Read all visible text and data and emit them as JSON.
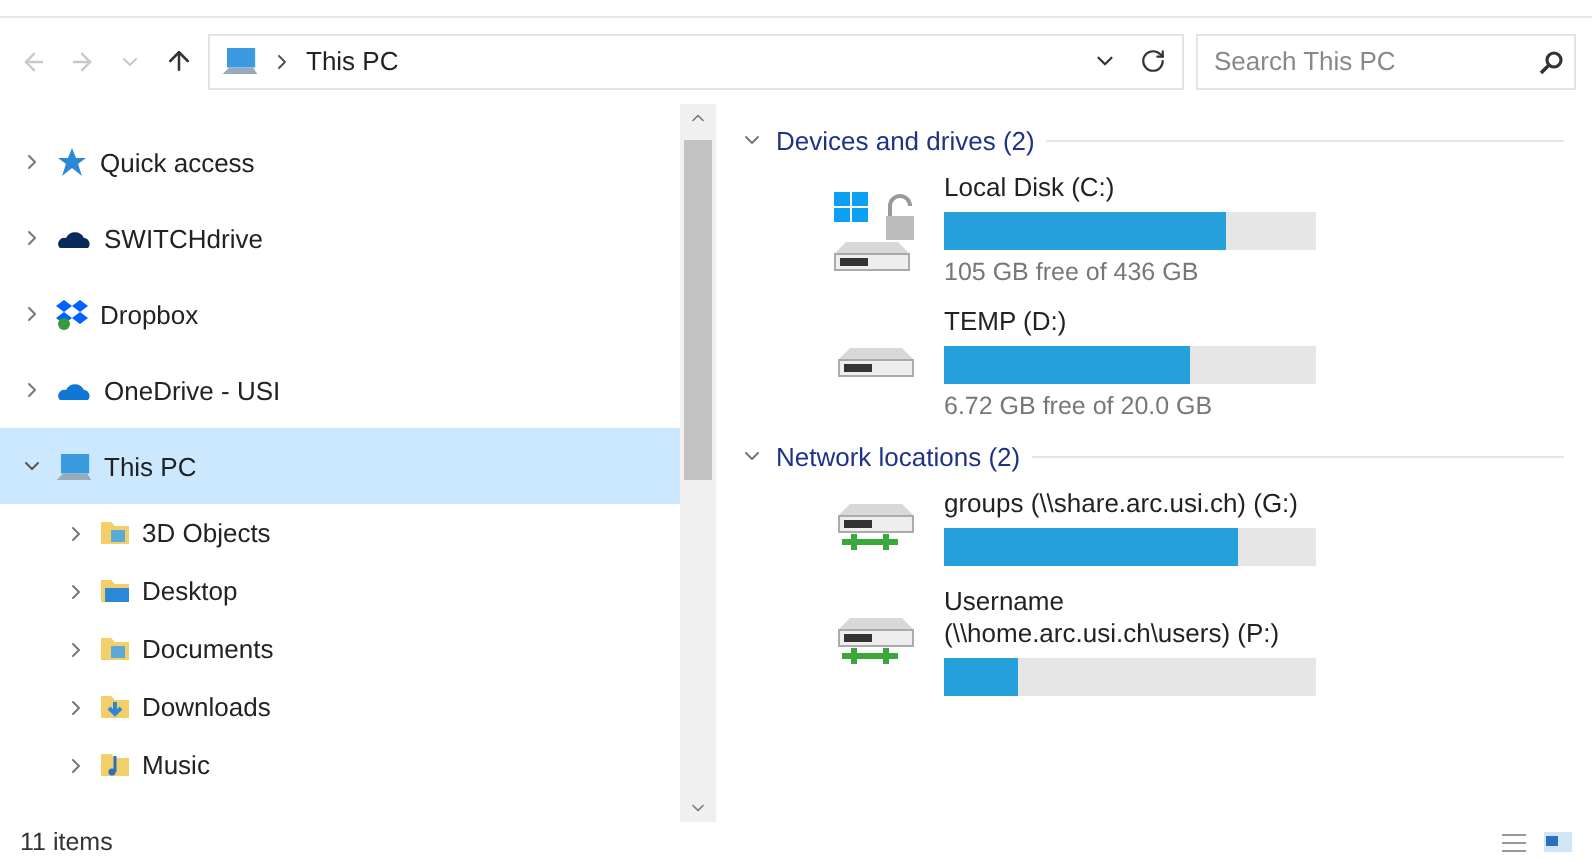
{
  "address_bar": {
    "path": "This PC"
  },
  "search": {
    "placeholder": "Search This PC"
  },
  "sidebar": {
    "items": [
      {
        "label": "Quick access",
        "kind": "star",
        "expanded": false,
        "selected": false
      },
      {
        "label": "SWITCHdrive",
        "kind": "darkcloud",
        "expanded": false,
        "selected": false
      },
      {
        "label": "Dropbox",
        "kind": "dropbox",
        "expanded": false,
        "selected": false
      },
      {
        "label": "OneDrive - USI",
        "kind": "cloud",
        "expanded": false,
        "selected": false
      },
      {
        "label": "This PC",
        "kind": "pc",
        "expanded": true,
        "selected": true,
        "children": [
          {
            "label": "3D Objects",
            "kind": "folder",
            "expanded": false,
            "selected": false
          },
          {
            "label": "Desktop",
            "kind": "desktop",
            "expanded": false,
            "selected": false
          },
          {
            "label": "Documents",
            "kind": "folder",
            "expanded": false,
            "selected": false
          },
          {
            "label": "Downloads",
            "kind": "downloads",
            "expanded": false,
            "selected": false
          },
          {
            "label": "Music",
            "kind": "music",
            "expanded": false,
            "selected": false
          }
        ]
      }
    ]
  },
  "groups": [
    {
      "title": "Devices and drives (2)",
      "expanded": true,
      "drives": [
        {
          "kind": "windows",
          "name": "Local Disk (C:)",
          "level": 0.76,
          "info": "105 GB free of 436 GB"
        },
        {
          "kind": "local",
          "name": "TEMP (D:)",
          "level": 0.66,
          "info": "6.72 GB free of 20.0 GB"
        }
      ]
    },
    {
      "title": "Network locations (2)",
      "expanded": true,
      "drives": [
        {
          "kind": "network",
          "name": "groups (\\\\share.arc.usi.ch) (G:)",
          "level": 0.79
        },
        {
          "kind": "network",
          "name": "Username (\\\\home.arc.usi.ch\\users) (P:)",
          "level": 0.2
        }
      ]
    }
  ],
  "status_bar": {
    "count": "11 items"
  }
}
